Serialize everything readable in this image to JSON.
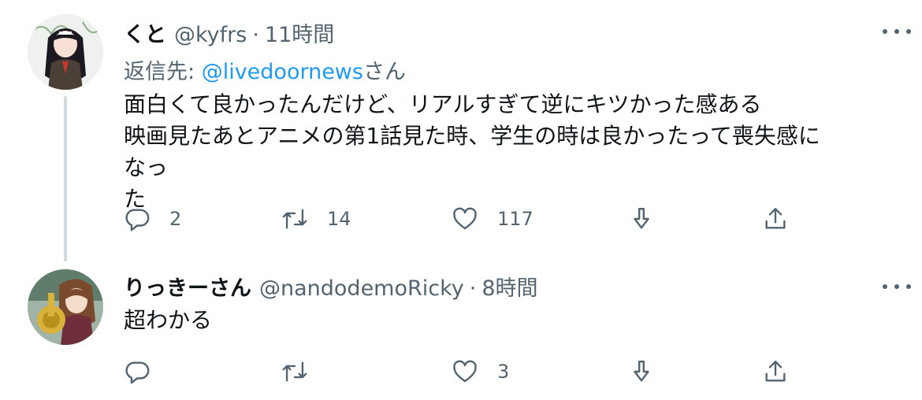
{
  "tweets": [
    {
      "name": "くと",
      "handle": "@kyfrs",
      "separator": "·",
      "time": "11時間",
      "reply_prefix": "返信先: ",
      "reply_handle": "@livedoornews",
      "reply_suffix": "さん",
      "text_lines": [
        "面白くて良かったんだけど、リアルすぎて逆にキツかった感ある",
        "映画見たあとアニメの第1話見た時、学生の時は良かったって喪失感になっ",
        "た"
      ],
      "replies": "2",
      "retweets": "14",
      "likes": "117"
    },
    {
      "name": "りっきーさん",
      "handle": "@nandodemoRicky",
      "separator": "·",
      "time": "8時間",
      "text_lines": [
        "超わかる"
      ],
      "replies": "",
      "retweets": "",
      "likes": "3"
    }
  ],
  "colors": {
    "text": "#0f1419",
    "secondary": "#536471",
    "link": "#1d9bf0",
    "thread_line": "#cfd9de"
  },
  "icons": [
    "reply-icon",
    "retweet-icon",
    "like-icon",
    "share-icon",
    "upload-icon",
    "more-icon"
  ]
}
